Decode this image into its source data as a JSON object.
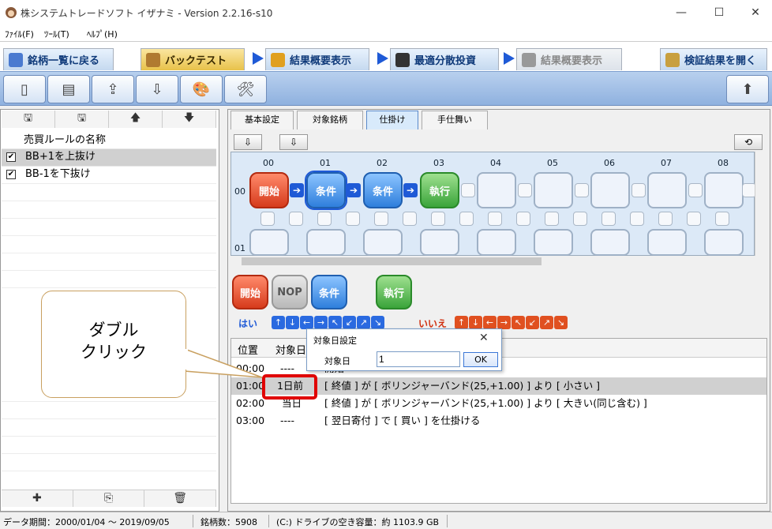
{
  "window": {
    "title": "株システムトレードソフト イザナミ - Version 2.2.16-s10",
    "minimize": "—",
    "maximize": "☐",
    "close": "✕"
  },
  "menu": {
    "items": [
      "ﾌｧｲﾙ(F)",
      "ﾂｰﾙ(T)",
      "ﾍﾙﾌﾟ(H)"
    ]
  },
  "nav": {
    "back": "銘柄一覧に戻る",
    "backtest": "バックテスト",
    "results": "結果概要表示",
    "optimal": "最適分散投資",
    "results2": "結果概要表示",
    "open_verify": "検証結果を開く"
  },
  "left": {
    "toolbar_icons": [
      "save-icon",
      "save-as-icon",
      "up-arrow-icon",
      "down-arrow-icon"
    ],
    "toolbar_glyphs": [
      "🖫",
      "🖫",
      "🡅",
      "🡇"
    ],
    "header": "売買ルールの名称",
    "rules": [
      {
        "name": "BB+1を上抜け",
        "checked": true
      },
      {
        "name": "BB-1を下抜け",
        "checked": true
      }
    ],
    "footer_glyphs": [
      "✚",
      "⎘",
      "🗑"
    ]
  },
  "tabs": [
    "基本設定",
    "対象銘柄",
    "仕掛け",
    "手仕舞い"
  ],
  "flow": {
    "columns": [
      "00",
      "01",
      "02",
      "03",
      "04",
      "05",
      "06",
      "07",
      "08"
    ],
    "rows": [
      "00",
      "01"
    ],
    "chip_labels": {
      "start": "開始",
      "cond": "条件",
      "exec": "執行",
      "nop": "NOP"
    },
    "refresh": "⟲"
  },
  "palette": {
    "yes": "はい",
    "no": "いいえ"
  },
  "conditions": {
    "headers": {
      "pos": "位置",
      "date": "対象日"
    },
    "rows": [
      {
        "pos": "00:00",
        "date": "----",
        "text": "開始"
      },
      {
        "pos": "01:00",
        "date": "1日前",
        "text": "[ 終値 ] が [ ボリンジャーバンド(25,+1.00) ] より [ 小さい ]"
      },
      {
        "pos": "02:00",
        "date": "当日",
        "text": "[ 終値 ] が [ ボリンジャーバンド(25,+1.00) ] より [ 大きい(同じ含む) ]"
      },
      {
        "pos": "03:00",
        "date": "----",
        "text": "[ 翌日寄付 ] で [ 買い ] を仕掛ける"
      }
    ]
  },
  "dialog": {
    "title": "対象日設定",
    "close": "✕",
    "label": "対象日",
    "value": "1",
    "ok": "OK"
  },
  "callout": {
    "line1": "ダブル",
    "line2": "クリック"
  },
  "status": {
    "period": "データ期間：2000/01/04 〜 2019/09/05",
    "count": "銘柄数：5908",
    "drive": "(C:) ドライブの空き容量：約 1103.9 GB"
  }
}
